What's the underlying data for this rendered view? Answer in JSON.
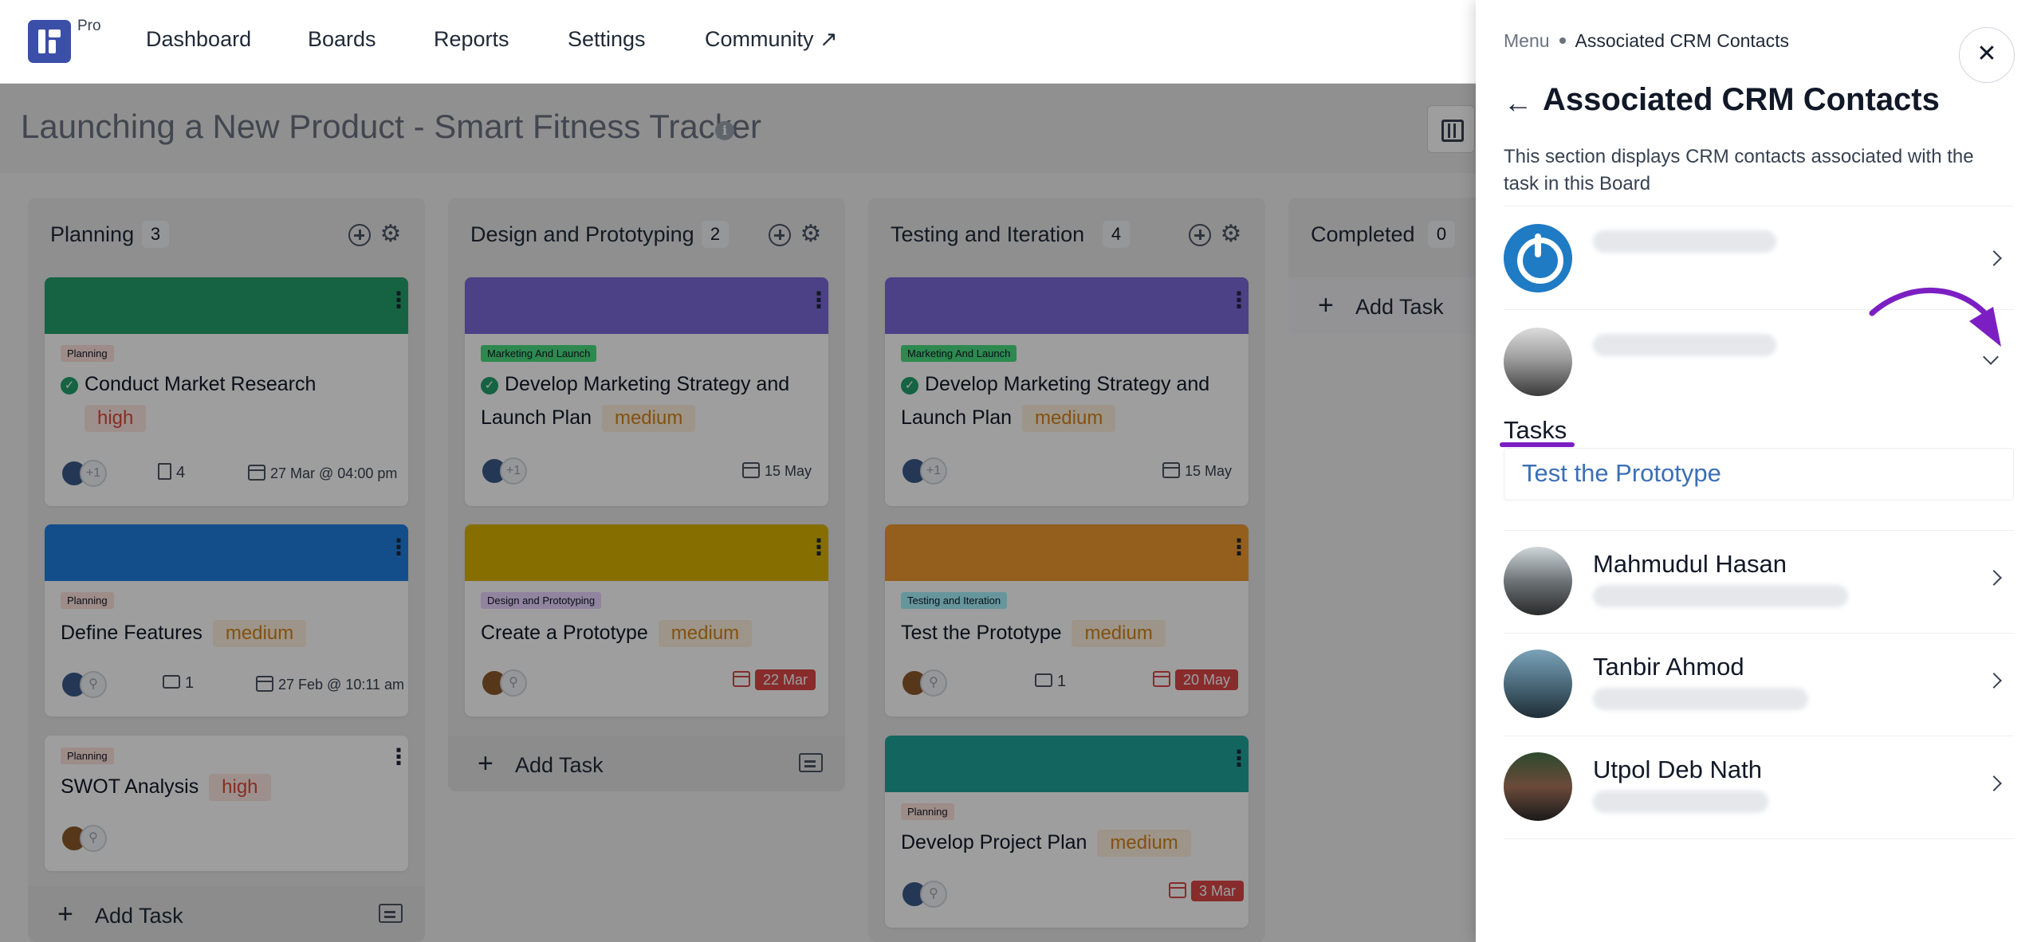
{
  "nav": {
    "badge": "Pro",
    "items": [
      "Dashboard",
      "Boards",
      "Reports",
      "Settings",
      "Community ↗"
    ]
  },
  "board": {
    "title": "Launching a New Product - Smart Fitness Tracker",
    "info_icon": "info-icon"
  },
  "columns": [
    {
      "title": "Planning",
      "count": "3",
      "add_task": "Add Task",
      "cards": [
        {
          "color": "#22a06b",
          "tag": "Planning",
          "tag_bg": "#fde2dc",
          "title": "Conduct Market Research",
          "done": true,
          "priority": "high",
          "extra": "+1",
          "attachments": "4",
          "due": "27 Mar @ 04:00 pm"
        },
        {
          "color": "#1f7fe0",
          "tag": "Planning",
          "tag_bg": "#fde2dc",
          "title": "Define Features",
          "done": false,
          "priority": "medium",
          "comments": "1",
          "due": "27 Feb @ 10:11 am"
        },
        {
          "color": "",
          "tag": "Planning",
          "tag_bg": "#fde2dc",
          "title": "SWOT Analysis",
          "done": false,
          "priority": "high"
        }
      ]
    },
    {
      "title": "Design and Prototyping",
      "count": "2",
      "add_task": "Add Task",
      "cards": [
        {
          "color": "#7b68d8",
          "tag": "Marketing And Launch",
          "tag_bg": "#4ade80",
          "title": "Develop Marketing Strategy and Launch Plan",
          "done": true,
          "priority": "medium",
          "extra": "+1",
          "due": "15 May"
        },
        {
          "color": "#d8b400",
          "tag": "Design and Prototyping",
          "tag_bg": "#e9d5ff",
          "title": "Create a Prototype",
          "done": false,
          "priority": "medium",
          "due": "22 Mar"
        }
      ]
    },
    {
      "title": "Testing and Iteration",
      "count": "4",
      "cards": [
        {
          "color": "#7b68d8",
          "tag": "Marketing And Launch",
          "tag_bg": "#4ade80",
          "title": "Develop Marketing Strategy and Launch Plan",
          "done": true,
          "priority": "medium",
          "extra": "+1",
          "due": "15 May"
        },
        {
          "color": "#ef9a2e",
          "tag": "Testing and Iteration",
          "tag_bg": "#a5f3fc",
          "title": "Test the Prototype",
          "done": false,
          "priority": "medium",
          "comments": "1",
          "due": "20 May"
        },
        {
          "color": "#1fa59a",
          "tag": "Planning",
          "tag_bg": "#fde2dc",
          "title": "Develop Project Plan",
          "done": false,
          "priority": "medium",
          "due": "3 Mar"
        }
      ]
    },
    {
      "title": "Completed",
      "count": "0",
      "add_task": "Add Task"
    }
  ],
  "panel": {
    "breadcrumb_root": "Menu",
    "breadcrumb_current": "Associated CRM Contacts",
    "title": "Associated CRM Contacts",
    "description": "This section displays CRM contacts associated with the task in this Board",
    "close_glyph": "✕",
    "back_glyph": "←",
    "tasks_label": "Tasks",
    "task_link": "Test the Prototype",
    "contacts": [
      {
        "name": "Mahmudul Hasan"
      },
      {
        "name": "Tanbir Ahmod"
      },
      {
        "name": "Utpol Deb Nath"
      }
    ],
    "accent": "#7c1fc2"
  }
}
